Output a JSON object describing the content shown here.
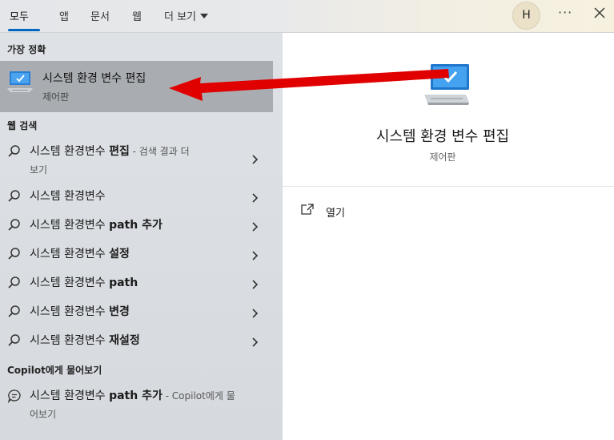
{
  "tabs": [
    {
      "label": "모두"
    },
    {
      "label": "앱"
    },
    {
      "label": "문서"
    },
    {
      "label": "웹"
    }
  ],
  "more_tab": {
    "label": "더 보기"
  },
  "avatar": {
    "initial": "H"
  },
  "ellipsis": {
    "label": "···"
  },
  "best_match": {
    "header": "가장 정확",
    "title": "시스템 환경 변수 편집",
    "subtitle": "제어판"
  },
  "web_search": {
    "header": "웹 검색",
    "items": [
      {
        "prefix": "시스템 환경변수 ",
        "bold": "편집",
        "hint": " - 검색 결과 더",
        "hint2": "보기"
      },
      {
        "prefix": "시스템 환경변수",
        "bold": ""
      },
      {
        "prefix": "시스템 환경변수 ",
        "bold": "path 추가"
      },
      {
        "prefix": "시스템 환경변수 ",
        "bold": "설정"
      },
      {
        "prefix": "시스템 환경변수 ",
        "bold": "path"
      },
      {
        "prefix": "시스템 환경변수 ",
        "bold": "변경"
      },
      {
        "prefix": "시스템 환경변수 ",
        "bold": "재설정"
      }
    ]
  },
  "copilot": {
    "header": "Copilot에게 물어보기",
    "prefix": "시스템 환경변수 ",
    "bold": "path 추가",
    "hint": " - Copilot에게 물",
    "hint2": "어보기"
  },
  "preview": {
    "title": "시스템 환경 변수 편집",
    "subtitle": "제어판",
    "action_open": "열기"
  },
  "colors": {
    "accent": "#0067c0",
    "annotation_arrow": "#e00000",
    "selected_row": "#a9adb1"
  },
  "icons": {
    "search": "search-icon",
    "chevron": "chevron-right-icon",
    "monitor": "monitor-settings-icon",
    "copilot": "chat-bubble-icon",
    "open": "open-external-icon",
    "close": "close-icon"
  }
}
